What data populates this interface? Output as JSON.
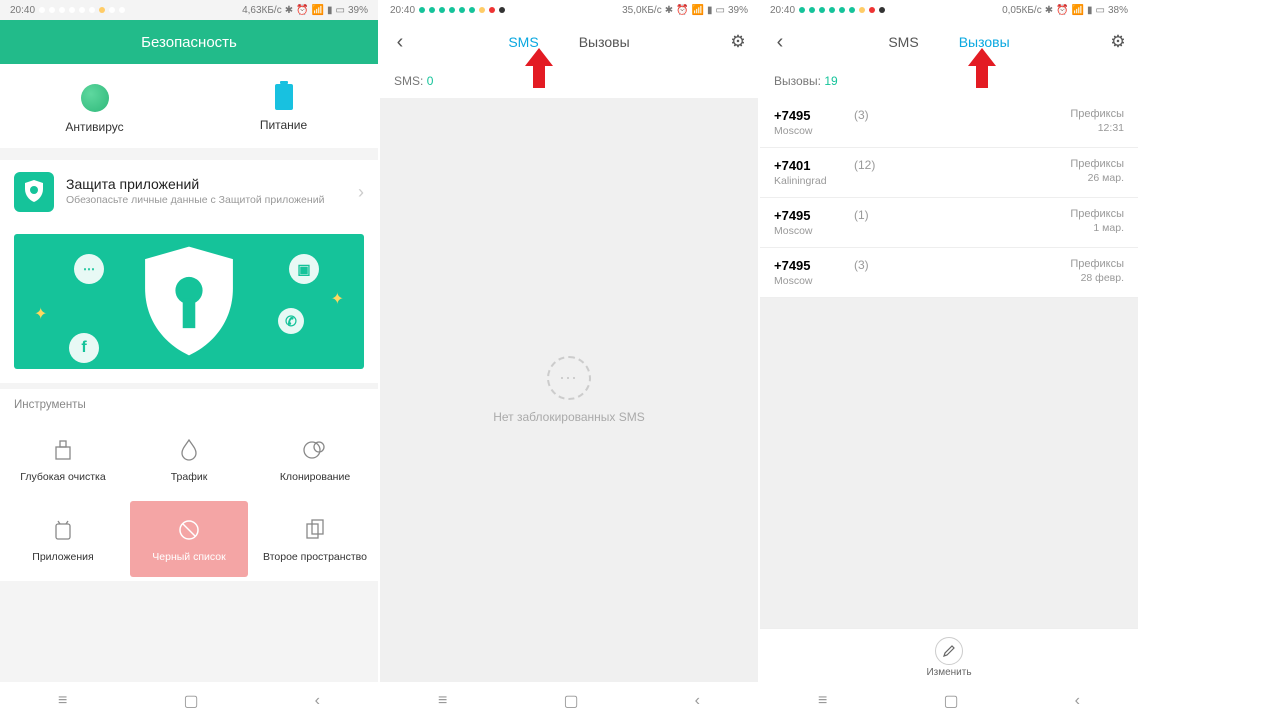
{
  "phone1": {
    "status": {
      "time": "20:40",
      "speed": "4,63КБ/с",
      "battery": "39%"
    },
    "title": "Безопасность",
    "features": [
      {
        "label": "Антивирус",
        "color": "#3ecf8e"
      },
      {
        "label": "Питание",
        "color": "#18c1e0"
      }
    ],
    "shield": {
      "title": "Защита приложений",
      "subtitle": "Обезопасьте личные данные с Защитой приложений"
    },
    "tools_label": "Инструменты",
    "tools": [
      {
        "label": "Глубокая очистка"
      },
      {
        "label": "Трафик"
      },
      {
        "label": "Клонирование"
      },
      {
        "label": "Приложения"
      },
      {
        "label": "Черный список",
        "highlight": true
      },
      {
        "label": "Второе пространство"
      }
    ]
  },
  "phone2": {
    "status": {
      "time": "20:40",
      "speed": "35,0КБ/с",
      "battery": "39%"
    },
    "tabs": {
      "sms": "SMS",
      "calls": "Вызовы",
      "active": "sms"
    },
    "count_label": "SMS:",
    "count_value": "0",
    "empty": "Нет заблокированных SMS"
  },
  "phone3": {
    "status": {
      "time": "20:40",
      "speed": "0,05КБ/с",
      "battery": "38%"
    },
    "tabs": {
      "sms": "SMS",
      "calls": "Вызовы",
      "active": "calls"
    },
    "count_label": "Вызовы:",
    "count_value": "19",
    "calls": [
      {
        "number": "+7495",
        "city": "Moscow",
        "count": "(3)",
        "prefix": "Префиксы",
        "time": "12:31"
      },
      {
        "number": "+7401",
        "city": "Kaliningrad",
        "count": "(12)",
        "prefix": "Префиксы",
        "time": "26 мар."
      },
      {
        "number": "+7495",
        "city": "Moscow",
        "count": "(1)",
        "prefix": "Префиксы",
        "time": "1 мар."
      },
      {
        "number": "+7495",
        "city": "Moscow",
        "count": "(3)",
        "prefix": "Префиксы",
        "time": "28 февр."
      }
    ],
    "edit_label": "Изменить"
  }
}
